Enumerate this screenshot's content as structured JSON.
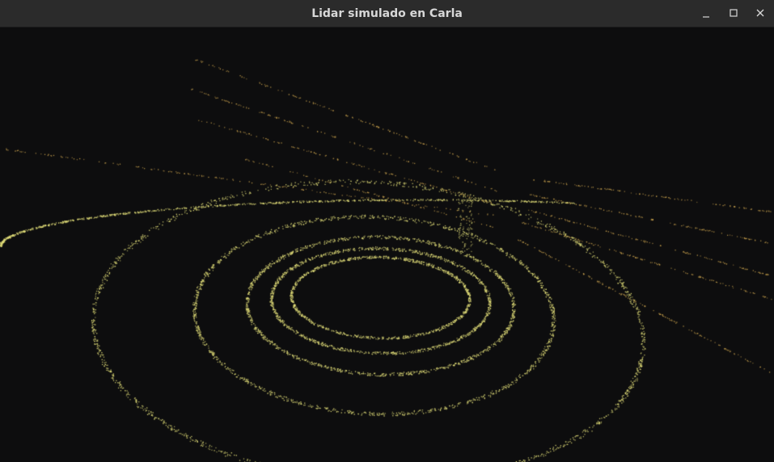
{
  "window": {
    "title": "Lidar simulado en Carla",
    "controls": {
      "minimize_icon": "minimize-icon",
      "maximize_icon": "maximize-icon",
      "close_icon": "close-icon"
    },
    "colors": {
      "titlebar_bg": "#2b2b2b",
      "title_text": "#d8d8d8",
      "viewport_bg": "#0d0d0e",
      "point_color_near": "#e3df7a",
      "point_color_far": "#c9a24e"
    }
  }
}
